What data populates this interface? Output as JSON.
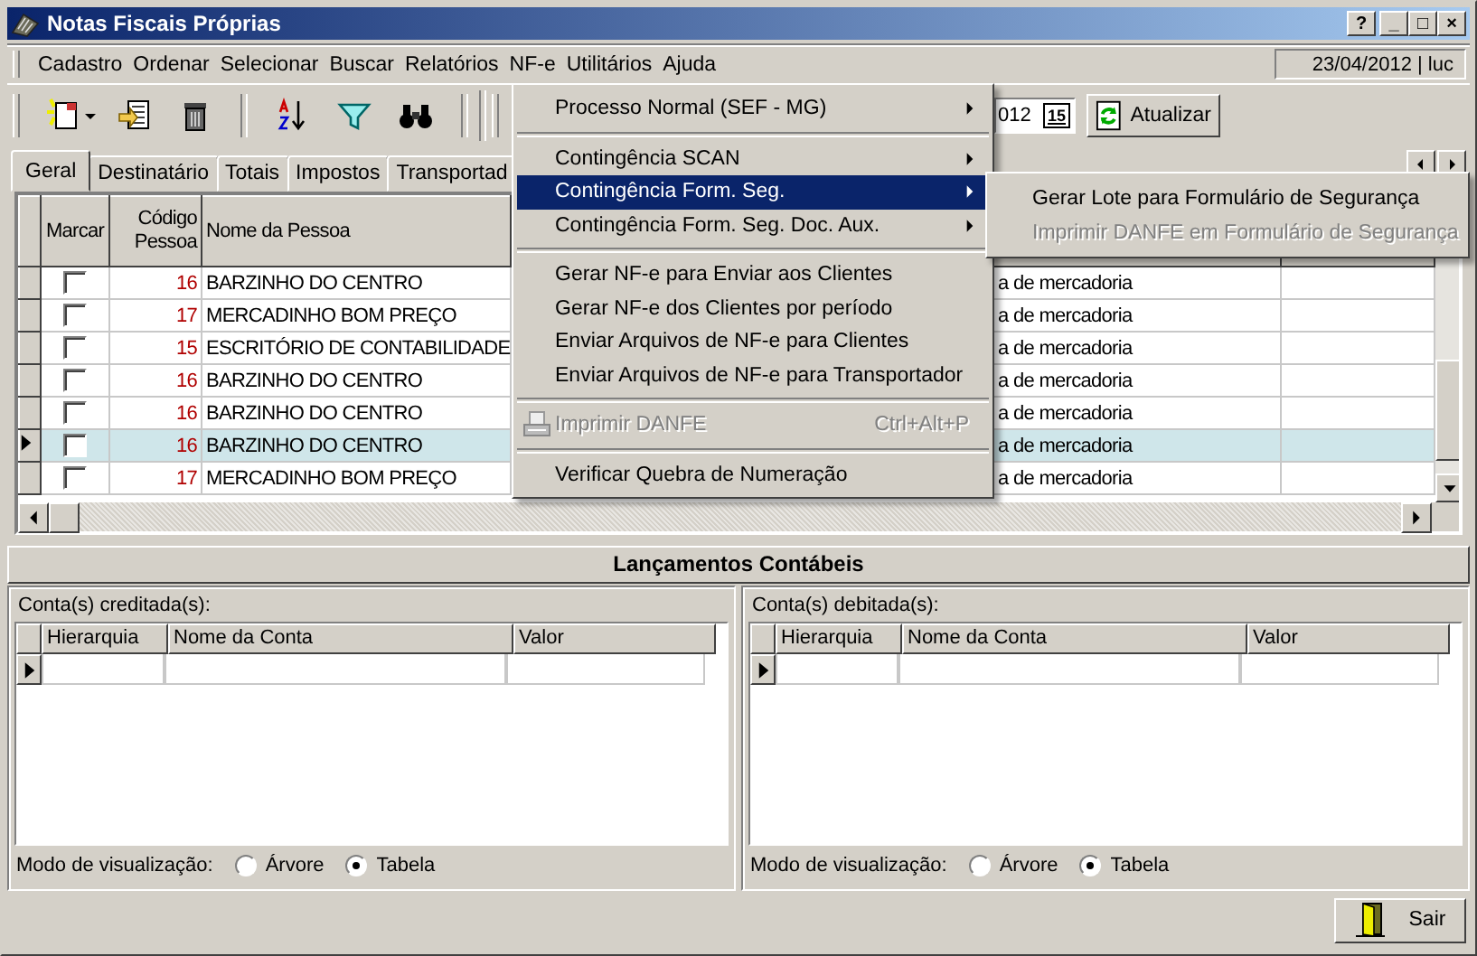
{
  "window": {
    "title": "Notas Fiscais Próprias",
    "controls": [
      "?",
      "_",
      "□",
      "×"
    ]
  },
  "menu_bar": [
    "Cadastro",
    "Ordenar",
    "Selecionar",
    "Buscar",
    "Relatórios",
    "NF-e",
    "Utilitários",
    "Ajuda"
  ],
  "session": "23/04/2012 | luc",
  "toolbar": {
    "date_value": "012",
    "calendar_day": "15",
    "refresh_button": "Atualizar"
  },
  "tabs": [
    {
      "label": "Geral",
      "selected": true
    },
    {
      "label": "Destinatário",
      "selected": false
    },
    {
      "label": "Totais",
      "selected": false
    },
    {
      "label": "Impostos",
      "selected": false
    },
    {
      "label": "Transportad",
      "selected": false
    }
  ],
  "grid": {
    "columns": [
      "Marcar",
      "Código Pessoa",
      "Nome da Pessoa"
    ],
    "rows": [
      {
        "checked": false,
        "code": "16",
        "name": "BARZINHO DO CENTRO",
        "column_5": "a de mercadoria",
        "selected": false
      },
      {
        "checked": false,
        "code": "17",
        "name": "MERCADINHO BOM PREÇO",
        "column_5": "a de mercadoria",
        "selected": false
      },
      {
        "checked": false,
        "code": "15",
        "name": "ESCRITÓRIO DE CONTABILIDADE",
        "column_5": "a de mercadoria",
        "selected": false
      },
      {
        "checked": false,
        "code": "16",
        "name": "BARZINHO DO CENTRO",
        "column_5": "a de mercadoria",
        "selected": false
      },
      {
        "checked": false,
        "code": "16",
        "name": "BARZINHO DO CENTRO",
        "column_5": "a de mercadoria",
        "selected": false
      },
      {
        "checked": false,
        "code": "16",
        "name": "BARZINHO DO CENTRO",
        "column_5": "a de mercadoria",
        "selected": true
      },
      {
        "checked": false,
        "code": "17",
        "name": "MERCADINHO BOM PREÇO",
        "column_5": "a de mercadoria",
        "selected": false
      }
    ]
  },
  "nfe_menu": [
    {
      "kind": "item",
      "label": "Processo Normal (SEF - MG)",
      "submenu": true,
      "selected": false,
      "disabled": false
    },
    {
      "kind": "separator"
    },
    {
      "kind": "item",
      "label": "Contingência SCAN",
      "submenu": true,
      "selected": false,
      "disabled": false
    },
    {
      "kind": "item",
      "label": "Contingência Form. Seg.",
      "submenu": true,
      "selected": true,
      "disabled": false
    },
    {
      "kind": "item",
      "label": "Contingência Form. Seg. Doc. Aux.",
      "submenu": true,
      "selected": false,
      "disabled": false
    },
    {
      "kind": "separator"
    },
    {
      "kind": "item",
      "label": "Gerar NF-e para Enviar aos Clientes",
      "submenu": false,
      "selected": false,
      "disabled": false
    },
    {
      "kind": "item",
      "label": "Gerar NF-e dos Clientes por período",
      "submenu": false,
      "selected": false,
      "disabled": false
    },
    {
      "kind": "item",
      "label": "Enviar Arquivos de NF-e para Clientes",
      "submenu": false,
      "selected": false,
      "disabled": false
    },
    {
      "kind": "item",
      "label": "Enviar Arquivos de NF-e para Transportador",
      "submenu": false,
      "selected": false,
      "disabled": false
    },
    {
      "kind": "separator"
    },
    {
      "kind": "item",
      "label": "Imprimir DANFE",
      "shortcut": "Ctrl+Alt+P",
      "icon": true,
      "submenu": false,
      "selected": false,
      "disabled": true
    },
    {
      "kind": "separator"
    },
    {
      "kind": "item",
      "label": "Verificar Quebra de Numeração",
      "submenu": false,
      "selected": false,
      "disabled": false
    }
  ],
  "submenu": [
    {
      "label": "Gerar Lote para Formulário de Segurança",
      "disabled": false
    },
    {
      "label": "Imprimir DANFE em Formulário de Segurança",
      "disabled": true
    }
  ],
  "ledger": {
    "title": "Lançamentos Contábeis",
    "panels": [
      {
        "title": "Conta(s) creditada(s):",
        "columns": [
          "Hierarquia",
          "Nome da Conta",
          "Valor"
        ],
        "view_label": "Modo de visualização:",
        "options": [
          {
            "label": "Árvore",
            "selected": false
          },
          {
            "label": "Tabela",
            "selected": true
          }
        ]
      },
      {
        "title": "Conta(s) debitada(s):",
        "columns": [
          "Hierarquia",
          "Nome da Conta",
          "Valor"
        ],
        "view_label": "Modo de visualização:",
        "options": [
          {
            "label": "Árvore",
            "selected": false
          },
          {
            "label": "Tabela",
            "selected": true
          }
        ]
      }
    ]
  },
  "exit_button": "Sair"
}
